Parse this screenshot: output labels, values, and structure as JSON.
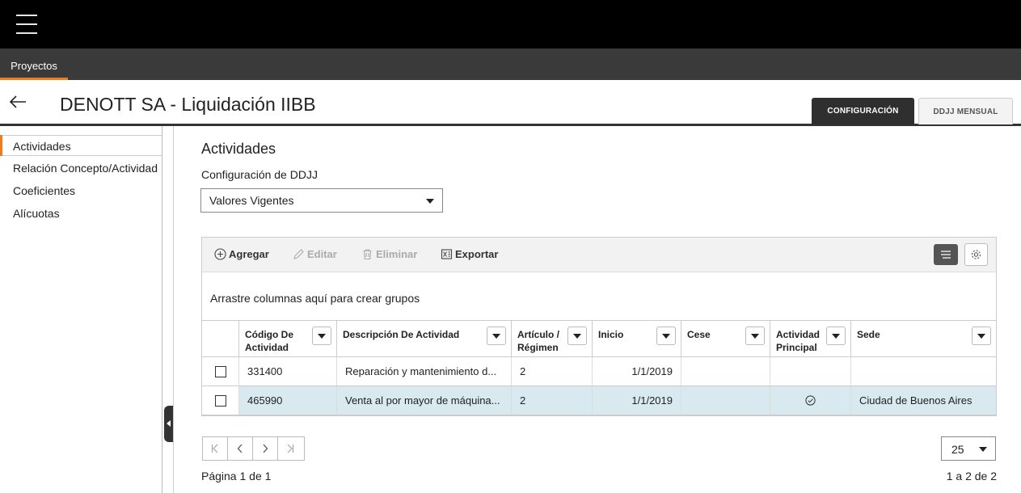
{
  "nav": {
    "tab_label": "Proyectos"
  },
  "header": {
    "title": "DENOTT SA - Liquidación IIBB",
    "tabs": [
      {
        "label": "CONFIGURACIÓN",
        "active": true
      },
      {
        "label": "DDJJ MENSUAL",
        "active": false
      }
    ]
  },
  "sidebar": {
    "items": [
      {
        "label": "Actividades",
        "active": true
      },
      {
        "label": "Relación Concepto/Actividad"
      },
      {
        "label": "Coeficientes"
      },
      {
        "label": "Alícuotas"
      }
    ]
  },
  "main": {
    "title": "Actividades",
    "config_label": "Configuración de DDJJ",
    "config_select": "Valores Vigentes"
  },
  "grid": {
    "toolbar": {
      "add": "Agregar",
      "edit": "Editar",
      "delete": "Eliminar",
      "export": "Exportar"
    },
    "group_hint": "Arrastre columnas aquí para crear grupos",
    "columns": [
      "Código De Actividad",
      "Descripción De Actividad",
      "Artículo / Régimen",
      "Inicio",
      "Cese",
      "Actividad Principal",
      "Sede"
    ],
    "rows": [
      {
        "codigo": "331400",
        "descripcion": "Reparación y mantenimiento d...",
        "articulo": "2",
        "inicio": "1/1/2019",
        "cese": "",
        "principal": false,
        "sede": "",
        "selected": false
      },
      {
        "codigo": "465990",
        "descripcion": "Venta al por mayor de máquina...",
        "articulo": "2",
        "inicio": "1/1/2019",
        "cese": "",
        "principal": true,
        "sede": "Ciudad de Buenos Aires",
        "selected": true
      }
    ]
  },
  "pagination": {
    "page_size": "25",
    "page_info": "Página 1 de 1",
    "range_info": "1 a 2 de 2"
  },
  "colors": {
    "accent": "#f07c1e",
    "selected_row": "#d8e9f0",
    "topbar": "#000000",
    "navbar": "#3a3a3a"
  }
}
